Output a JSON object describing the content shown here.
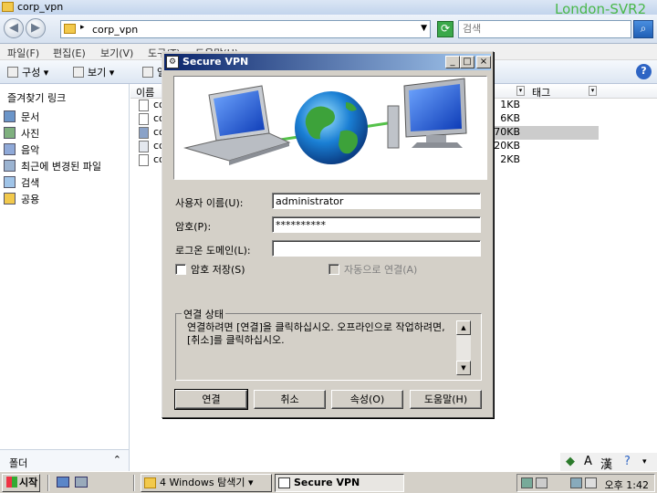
{
  "explorer": {
    "title": "corp_vpn",
    "address": "corp_vpn",
    "search_placeholder": "검색",
    "watermark": "London-SVR2",
    "menu": [
      "파일(F)",
      "편집(E)",
      "보기(V)",
      "도구(T)",
      "도움말(H)"
    ],
    "toolbar": {
      "organize": "구성",
      "views": "보기",
      "burn": "열기"
    },
    "favorites_title": "즐겨찾기 링크",
    "favorites": [
      "문서",
      "사진",
      "음악",
      "최근에 변경된 파일",
      "검색",
      "공용"
    ],
    "folders_label": "폴더",
    "columns": {
      "name": "이름",
      "tags": "태그"
    },
    "files": [
      {
        "name": "co",
        "size": "1KB"
      },
      {
        "name": "co",
        "size": "6KB"
      },
      {
        "name": "co",
        "size": "270KB"
      },
      {
        "name": "co",
        "size": "20KB"
      },
      {
        "name": "co",
        "size": "2KB"
      }
    ]
  },
  "dialog": {
    "title": "Secure VPN",
    "username_label": "사용자 이름(U):",
    "username_value": "administrator",
    "password_label": "암호(P):",
    "password_value": "**********",
    "domain_label": "로그온 도메인(L):",
    "domain_value": "",
    "save_password_label": "암호 저장(S)",
    "auto_connect_label": "자동으로 연결(A)",
    "status_group_label": "연결 상태",
    "status_text": "연결하려면 [연결]을 클릭하십시오. 오프라인으로 작업하려면, [취소]를 클릭하십시오.",
    "buttons": {
      "connect": "연결",
      "cancel": "취소",
      "properties": "속성(O)",
      "help": "도움말(H)"
    }
  },
  "taskbar": {
    "start_label": "시작",
    "tasks": [
      "4 Windows 탐색기",
      "Secure VPN"
    ],
    "clock": "오후 1:42"
  },
  "statusbar": {
    "lang_a": "A",
    "lang_han": "漢"
  }
}
